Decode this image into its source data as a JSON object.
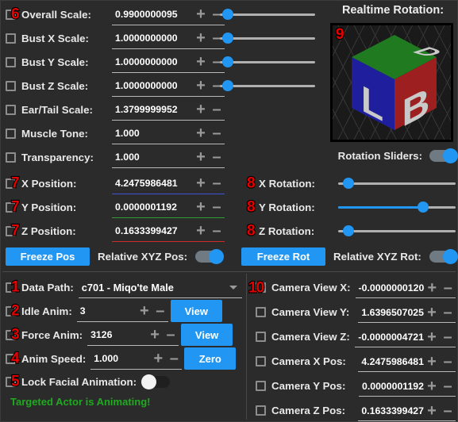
{
  "scale_rows": [
    {
      "badge": "6",
      "checkbox": true,
      "label": "Overall Scale:",
      "value": "0.9900000095",
      "slider_pct": 8
    },
    {
      "badge": "",
      "checkbox": true,
      "label": "Bust X Scale:",
      "value": "1.0000000000",
      "slider_pct": 8
    },
    {
      "badge": "",
      "checkbox": true,
      "label": "Bust Y Scale:",
      "value": "1.0000000000",
      "slider_pct": 8
    },
    {
      "badge": "",
      "checkbox": true,
      "label": "Bust Z Scale:",
      "value": "1.0000000000",
      "slider_pct": 8
    },
    {
      "badge": "",
      "checkbox": true,
      "label": "Ear/Tail Scale:",
      "value": "1.3799999952",
      "slider_pct": 0
    },
    {
      "badge": "",
      "checkbox": true,
      "label": "Muscle Tone:",
      "value": "1.000",
      "slider_pct": 0
    },
    {
      "badge": "",
      "checkbox": true,
      "label": "Transparency:",
      "value": "1.000",
      "slider_pct": 0
    }
  ],
  "position_rows": [
    {
      "badge": "7",
      "label": "X Position:",
      "value": "4.2475986481",
      "underline": "blue"
    },
    {
      "badge": "7",
      "label": "Y Position:",
      "value": "0.0000001192",
      "underline": "green"
    },
    {
      "badge": "7",
      "label": "Z Position:",
      "value": "0.1633399427",
      "underline": "red"
    }
  ],
  "freeze_pos_label": "Freeze Pos",
  "relative_pos_label": "Relative XYZ Pos:",
  "relative_pos_state": "on",
  "rotation_heading": "Realtime Rotation:",
  "cube": {
    "badge": "9",
    "face_left_letter": "L",
    "face_right_letter": "B",
    "face_top_letter": "D",
    "color_left": "#1f1f9e",
    "color_right": "#9e1f1f",
    "color_top": "#1f7a20"
  },
  "rotation_sliders_label": "Rotation Sliders:",
  "rotation_sliders_state": "on",
  "rotation_rows": [
    {
      "badge": "8",
      "label": "X Rotation:",
      "slider_pct": 9,
      "filled": false
    },
    {
      "badge": "8",
      "label": "Y Rotation:",
      "slider_pct": 72,
      "filled": true
    },
    {
      "badge": "8",
      "label": "Z Rotation:",
      "slider_pct": 9,
      "filled": false
    }
  ],
  "freeze_rot_label": "Freeze Rot",
  "relative_rot_label": "Relative XYZ Rot:",
  "relative_rot_state": "on",
  "anim_section": {
    "data_path": {
      "badge": "1",
      "label": "Data Path:",
      "value": "c701 - Miqo'te Male"
    },
    "idle_anim": {
      "badge": "2",
      "label": "Idle Anim:",
      "value": "3",
      "button": "View"
    },
    "force_anim": {
      "badge": "3",
      "label": "Force Anim:",
      "value": "3126",
      "button": "View"
    },
    "anim_speed": {
      "badge": "4",
      "label": "Anim Speed:",
      "value": "1.000",
      "button": "Zero"
    },
    "lock_facial": {
      "badge": "5",
      "label": "Lock Facial Animation:",
      "state": "off"
    },
    "status": "Targeted Actor is Animating!"
  },
  "camera_rows": [
    {
      "badge": "10",
      "checkbox": true,
      "label": "Camera View X:",
      "value": "-0.0000000120"
    },
    {
      "badge": "",
      "checkbox": true,
      "label": "Camera View Y:",
      "value": "1.6396507025"
    },
    {
      "badge": "",
      "checkbox": true,
      "label": "Camera View Z:",
      "value": "-0.0000004721"
    },
    {
      "badge": "",
      "checkbox": true,
      "label": "Camera X Pos:",
      "value": "4.2475986481"
    },
    {
      "badge": "",
      "checkbox": true,
      "label": "Camera Y Pos:",
      "value": "0.0000001192"
    },
    {
      "badge": "",
      "checkbox": true,
      "label": "Camera Z Pos:",
      "value": "0.1633399427"
    }
  ],
  "icons": {
    "plus": "+",
    "minus": "–"
  },
  "colors": {
    "accent": "#2196f3",
    "badge": "#e60000",
    "status": "#1faa1f",
    "bg": "#2b2b2b"
  }
}
